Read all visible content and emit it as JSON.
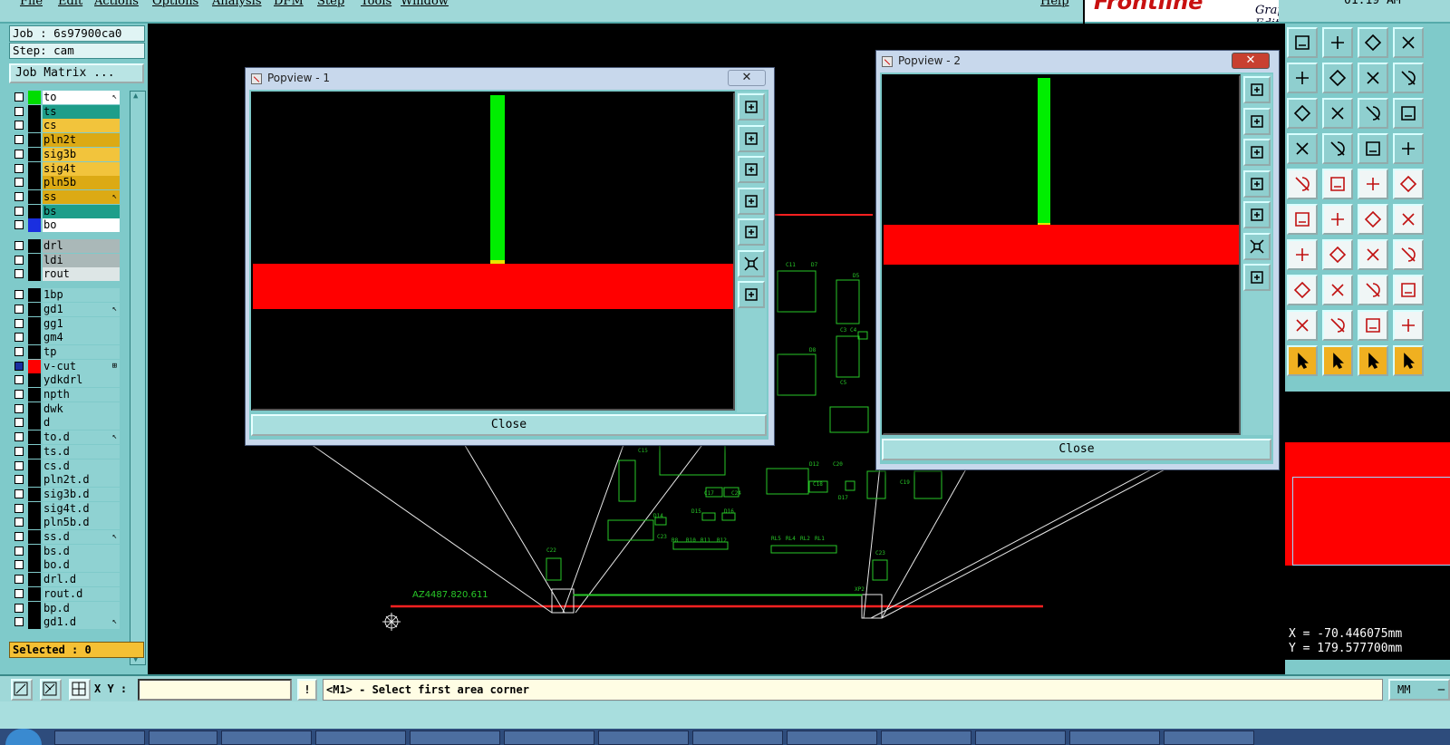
{
  "menu": {
    "items": [
      "File",
      "Edit",
      "Actions",
      "Options",
      "Analysis",
      "DFM",
      "Step",
      "Tools",
      "Window"
    ],
    "help": "Help"
  },
  "logo": {
    "brand": "Frontline",
    "subtitle": "Graphic Editor"
  },
  "clock": "01:19 AM",
  "job": {
    "label": "Job : 6s97900ca0",
    "step": "Step: cam",
    "matrix_button": "Job Matrix ..."
  },
  "layers": [
    {
      "name": "to",
      "color": "#ffffff",
      "swatch": "#00dd00",
      "mark": "↖"
    },
    {
      "name": "ts",
      "color": "#1e9e8a",
      "swatch": "#000000",
      "mark": ""
    },
    {
      "name": "cs",
      "color": "#f2c43c",
      "swatch": "#000000",
      "mark": ""
    },
    {
      "name": "pln2t",
      "color": "#dcaa14",
      "swatch": "#000000",
      "mark": ""
    },
    {
      "name": "sig3b",
      "color": "#f2c43c",
      "swatch": "#000000",
      "mark": ""
    },
    {
      "name": "sig4t",
      "color": "#f2c43c",
      "swatch": "#000000",
      "mark": ""
    },
    {
      "name": "pln5b",
      "color": "#dcaa14",
      "swatch": "#000000",
      "mark": ""
    },
    {
      "name": "ss",
      "color": "#dcaa14",
      "swatch": "#000000",
      "mark": "↖"
    },
    {
      "name": "bs",
      "color": "#1e9e8a",
      "swatch": "#000000",
      "mark": ""
    },
    {
      "name": "bo",
      "color": "#ffffff",
      "swatch": "#1a2fe0",
      "mark": ""
    },
    {
      "name": "drl",
      "color": "#aab8b8",
      "swatch": "#000000",
      "mark": ""
    },
    {
      "name": "ldi",
      "color": "#aab8b8",
      "swatch": "#000000",
      "mark": ""
    },
    {
      "name": "rout",
      "color": "#dde6e6",
      "swatch": "#000000",
      "mark": ""
    },
    {
      "name": "1bp",
      "color": "#8fd2d2",
      "swatch": "#000000",
      "mark": ""
    },
    {
      "name": "gd1",
      "color": "#8fd2d2",
      "swatch": "#000000",
      "mark": "↖"
    },
    {
      "name": "gg1",
      "color": "#8fd2d2",
      "swatch": "#000000",
      "mark": ""
    },
    {
      "name": "gm4",
      "color": "#8fd2d2",
      "swatch": "#000000",
      "mark": ""
    },
    {
      "name": "tp",
      "color": "#8fd2d2",
      "swatch": "#000000",
      "mark": ""
    },
    {
      "name": "v-cut",
      "color": "#8fd2d2",
      "swatch": "#ff0000",
      "mark": "⊞",
      "checked": true
    },
    {
      "name": "ydkdrl",
      "color": "#8fd2d2",
      "swatch": "#000000",
      "mark": ""
    },
    {
      "name": "npth",
      "color": "#8fd2d2",
      "swatch": "#000000",
      "mark": ""
    },
    {
      "name": "dwk",
      "color": "#8fd2d2",
      "swatch": "#000000",
      "mark": ""
    },
    {
      "name": "d",
      "color": "#8fd2d2",
      "swatch": "#000000",
      "mark": ""
    },
    {
      "name": "to.d",
      "color": "#8fd2d2",
      "swatch": "#000000",
      "mark": "↖"
    },
    {
      "name": "ts.d",
      "color": "#8fd2d2",
      "swatch": "#000000",
      "mark": ""
    },
    {
      "name": "cs.d",
      "color": "#8fd2d2",
      "swatch": "#000000",
      "mark": ""
    },
    {
      "name": "pln2t.d",
      "color": "#8fd2d2",
      "swatch": "#000000",
      "mark": ""
    },
    {
      "name": "sig3b.d",
      "color": "#8fd2d2",
      "swatch": "#000000",
      "mark": ""
    },
    {
      "name": "sig4t.d",
      "color": "#8fd2d2",
      "swatch": "#000000",
      "mark": ""
    },
    {
      "name": "pln5b.d",
      "color": "#8fd2d2",
      "swatch": "#000000",
      "mark": ""
    },
    {
      "name": "ss.d",
      "color": "#8fd2d2",
      "swatch": "#000000",
      "mark": "↖"
    },
    {
      "name": "bs.d",
      "color": "#8fd2d2",
      "swatch": "#000000",
      "mark": ""
    },
    {
      "name": "bo.d",
      "color": "#8fd2d2",
      "swatch": "#000000",
      "mark": ""
    },
    {
      "name": "drl.d",
      "color": "#8fd2d2",
      "swatch": "#000000",
      "mark": ""
    },
    {
      "name": "rout.d",
      "color": "#8fd2d2",
      "swatch": "#000000",
      "mark": ""
    },
    {
      "name": "bp.d",
      "color": "#8fd2d2",
      "swatch": "#000000",
      "mark": ""
    },
    {
      "name": "gd1.d",
      "color": "#8fd2d2",
      "swatch": "#000000",
      "mark": "↖"
    }
  ],
  "selected": "Selected : 0",
  "popview1": {
    "title": "Popview - 1",
    "close_label": "Close",
    "close_x": "✕"
  },
  "popview2": {
    "title": "Popview - 2",
    "close_label": "Close",
    "close_x": "✕"
  },
  "board": {
    "label": "AZ4487.820.611"
  },
  "coords": {
    "x": "X = -70.446075mm",
    "y": "Y = 179.577700mm"
  },
  "bottom": {
    "xy_label": "X Y :",
    "xy_value": "",
    "excl": "!",
    "prompt": "<M1> - Select first area corner",
    "units": "MM"
  },
  "colors": {
    "highlight_red": "#ff0000",
    "trace_green": "#00dd00",
    "panel": "#7fcaca"
  }
}
